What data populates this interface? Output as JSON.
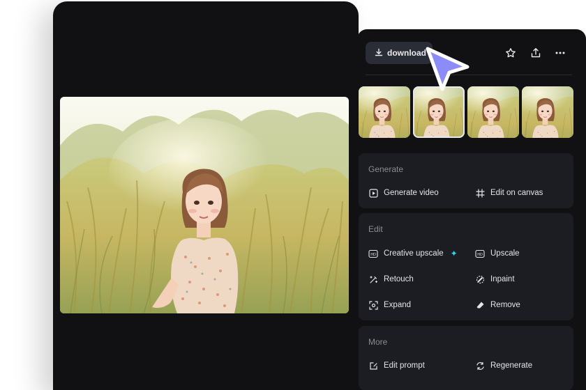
{
  "toolbar": {
    "download_label": "download",
    "icons": [
      "download-icon",
      "star-icon",
      "share-icon",
      "more-icon"
    ]
  },
  "thumbnails": [
    {
      "selected": false
    },
    {
      "selected": true
    },
    {
      "selected": false
    },
    {
      "selected": false
    }
  ],
  "sections": {
    "generate": {
      "title": "Generate",
      "items": [
        {
          "label": "Generate video",
          "icon": "play-square-icon"
        },
        {
          "label": "Edit on canvas",
          "icon": "canvas-icon"
        }
      ]
    },
    "edit": {
      "title": "Edit",
      "items": [
        {
          "label": "Creative upscale",
          "icon": "hd-upscale-icon"
        },
        {
          "label": "Upscale",
          "icon": "hd-icon"
        },
        {
          "label": "Retouch",
          "icon": "magic-wand-icon"
        },
        {
          "label": "Inpaint",
          "icon": "brush-icon"
        },
        {
          "label": "Expand",
          "icon": "expand-icon"
        },
        {
          "label": "Remove",
          "icon": "eraser-icon"
        }
      ]
    },
    "more": {
      "title": "More",
      "items": [
        {
          "label": "Edit prompt",
          "icon": "edit-prompt-icon"
        },
        {
          "label": "Regenerate",
          "icon": "regenerate-icon"
        }
      ]
    }
  },
  "colors": {
    "panel_bg": "#111114",
    "section_bg": "#1c1d22",
    "button_bg": "#2b2d36",
    "cursor_fill": "#8b8cf5",
    "sparkle": "#31d6e8"
  }
}
